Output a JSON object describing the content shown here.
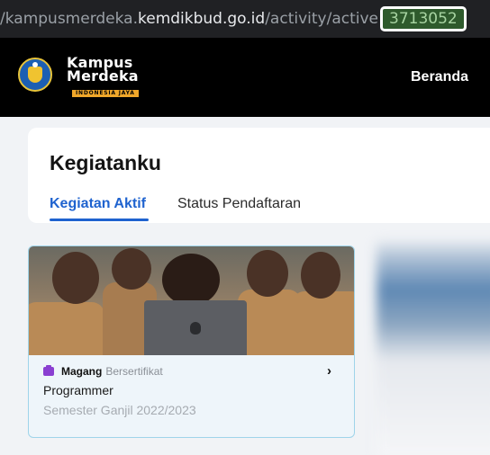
{
  "browser": {
    "url_prefix": "/kampusmerdeka.",
    "url_domain": "kemdikbud.go.id",
    "url_path": "/activity/active",
    "url_id_highlighted": "3713052"
  },
  "header": {
    "logo_line1": "Kampus",
    "logo_line2": "Merdeka",
    "logo_tag": "INDONESIA JAYA",
    "nav_beranda": "Beranda"
  },
  "page": {
    "title": "Kegiatanku",
    "tabs": [
      {
        "label": "Kegiatan Aktif",
        "active": true
      },
      {
        "label": "Status Pendaftaran",
        "active": false
      }
    ]
  },
  "activity": {
    "badge_icon": "briefcase-icon",
    "badge_color": "#8a3fd1",
    "program_type": "Magang",
    "program_sub": "Bersertifikat",
    "role": "Programmer",
    "semester": "Semester Ganjil 2022/2023",
    "chevron": "›"
  },
  "colors": {
    "accent": "#1f63cf",
    "header_bg": "#000000",
    "card_border": "#9fd4ea"
  }
}
